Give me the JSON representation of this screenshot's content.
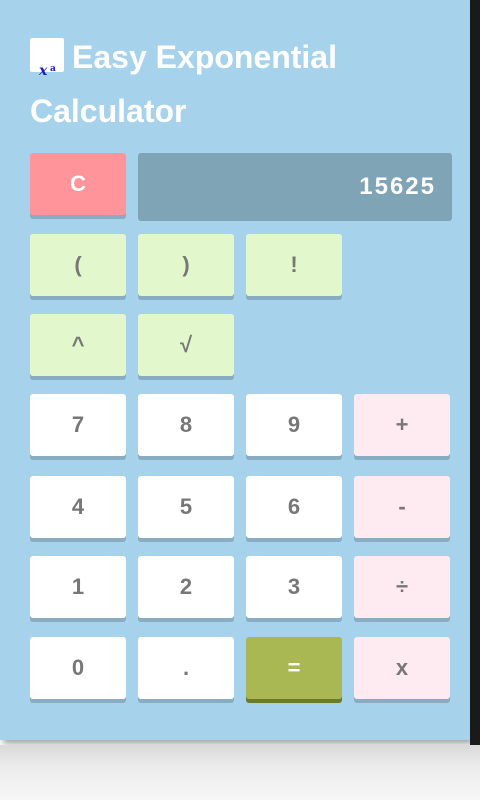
{
  "app": {
    "title": "Easy Exponential Calculator",
    "logo_base": "x",
    "logo_sup": "a"
  },
  "display": {
    "value": "15625"
  },
  "buttons": {
    "clear": "C",
    "lparen": "(",
    "rparen": ")",
    "factorial": "!",
    "power": "^",
    "sqrt": "√",
    "seven": "7",
    "eight": "8",
    "nine": "9",
    "plus": "+",
    "four": "4",
    "five": "5",
    "six": "6",
    "minus": "-",
    "one": "1",
    "two": "2",
    "three": "3",
    "divide": "÷",
    "zero": "0",
    "dot": ".",
    "equals": "=",
    "multiply": "x"
  },
  "colors": {
    "background": "#a6d2ec",
    "clear": "#ff959a",
    "display": "#7fa4b5",
    "function_keys": "#e2f8cc",
    "operator_keys": "#fdebf1",
    "equals": "#a9b853"
  }
}
